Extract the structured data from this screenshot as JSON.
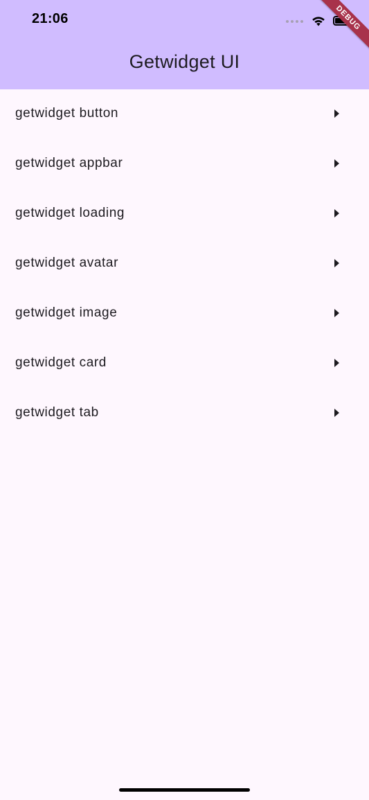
{
  "status_bar": {
    "time": "21:06",
    "icons": [
      "signal-icon",
      "wifi-icon",
      "battery-icon"
    ]
  },
  "debug_banner": {
    "label": "DEBUG",
    "color": "#a8324b"
  },
  "appbar": {
    "title": "Getwidget UI",
    "background": "#d0bcff"
  },
  "list": {
    "items": [
      {
        "label": "getwidget button",
        "icon": "arrow-right-icon"
      },
      {
        "label": "getwidget appbar",
        "icon": "arrow-right-icon"
      },
      {
        "label": "getwidget loading",
        "icon": "arrow-right-icon"
      },
      {
        "label": "getwidget avatar",
        "icon": "arrow-right-icon"
      },
      {
        "label": "getwidget image",
        "icon": "arrow-right-icon"
      },
      {
        "label": "getwidget card",
        "icon": "arrow-right-icon"
      },
      {
        "label": "getwidget tab",
        "icon": "arrow-right-icon"
      }
    ]
  },
  "colors": {
    "page_background": "#fef7fe",
    "text": "#1d1b20"
  }
}
